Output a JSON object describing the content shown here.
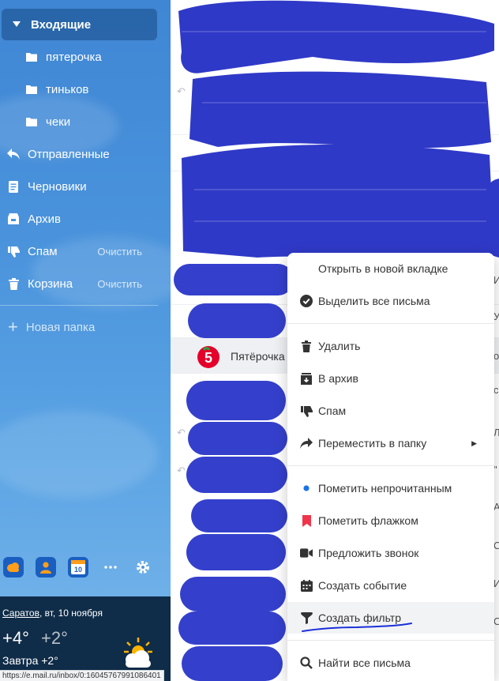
{
  "sidebar": {
    "inbox": "Входящие",
    "folders": [
      "пятерочка",
      "тиньков",
      "чеки"
    ],
    "sent": "Отправленные",
    "drafts": "Черновики",
    "archive": "Архив",
    "spam": "Спам",
    "trash": "Корзина",
    "clear_label": "Очистить",
    "new_folder": "Новая папка"
  },
  "apps": {
    "calendar_day": "10"
  },
  "weather": {
    "city": "Саратов",
    "date": ", вт, 10 ноября",
    "temp_now": "+4°",
    "temp_feels": "+2°",
    "tomorrow": "Завтра +2°"
  },
  "status_url": "https://e.mail.ru/inbox/0:16045767991086401",
  "mail_list": {
    "highlighted_sender": "Пятёрочка",
    "right_letters": [
      "И",
      "У",
      "о",
      "с",
      "Л",
      "\"",
      "А",
      "С",
      "И",
      "С"
    ]
  },
  "context_menu": {
    "items": [
      "Открыть в новой вкладке",
      "Выделить все письма",
      "Удалить",
      "В архив",
      "Спам",
      "Переместить в папку",
      "Пометить непрочитанным",
      "Пометить флажком",
      "Предложить звонок",
      "Создать событие",
      "Создать фильтр",
      "Найти все письма"
    ]
  },
  "colors": {
    "sidebar_blue": "#4a93dc",
    "scribble_blue": "#2f39c7",
    "unread_dot": "#1a73e8",
    "flag_red": "#f0344a",
    "annotation_blue": "#1a2fd8"
  }
}
